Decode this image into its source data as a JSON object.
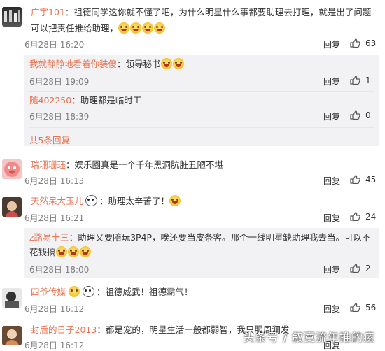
{
  "comments": [
    {
      "username": "广宇101",
      "sep": "：",
      "text": "祖德同学这你就不懂了吧，为什么明星什么事都要助理去打理，就是出了问题可以把责任推给助理，",
      "emoji": [
        "laugh-cry-emoji",
        "laugh-cry-emoji",
        "laugh-cry-emoji",
        "laugh-cry-emoji"
      ],
      "date": "6月28日 16:20",
      "reply": "回复",
      "likes": "63",
      "replies": [
        {
          "username": "我就静静地看着你装傻",
          "sep": "：",
          "text": "领导秘书",
          "emoji": [
            "laugh-cry-emoji",
            "laugh-cry-emoji"
          ],
          "date": "6月28日 19:09",
          "reply": "回复",
          "likes": "1"
        },
        {
          "username": "随402250",
          "sep": "：",
          "text": "助理都是临时工",
          "date": "6月28日 18:39",
          "reply": "回复",
          "likes": "0"
        }
      ],
      "more_replies": "共5条回复"
    },
    {
      "username": "瑞珊珊珏",
      "sep": "：",
      "text": "娱乐圈真是一个千年黑洞肮脏丑陋不堪",
      "date": "6月28日 16:13",
      "reply": "回复",
      "likes": "45"
    },
    {
      "username": "天然呆大玉儿",
      "sep": "：",
      "text": "助理太辛苦了！",
      "emoji": [
        "laugh-cry-emoji"
      ],
      "date": "6月28日 16:21",
      "reply": "回复",
      "likes": "24",
      "replies": [
        {
          "username": "z路易十三",
          "sep": "：",
          "text": "助理又要陪玩3P4P，唉还要当皮条客。那个一线明星缺助理我去当。可以不花钱搞",
          "emoji": [
            "laughing-emoji",
            "laughing-emoji",
            "laughing-emoji"
          ],
          "date": "6月28日 18:00",
          "reply": "回复",
          "likes": "2"
        }
      ]
    },
    {
      "username": "四爷传媒",
      "sep": "：",
      "text": "祖德威武！祖德霸气！",
      "date": "6月28日 16:12",
      "reply": "回复",
      "likes": "56"
    },
    {
      "username": "封后的日子2013",
      "sep": "：",
      "text": "都是宠的，明星生活一般都弱智，我只服周润发",
      "date": "6月28日 16:12",
      "reply": "回复",
      "likes": ""
    }
  ],
  "watermark": "头条号 / 叙寞流年推的痃",
  "colors": {
    "username": "#eb7350",
    "meta": "#808080",
    "subbg": "#f2f2f5"
  }
}
